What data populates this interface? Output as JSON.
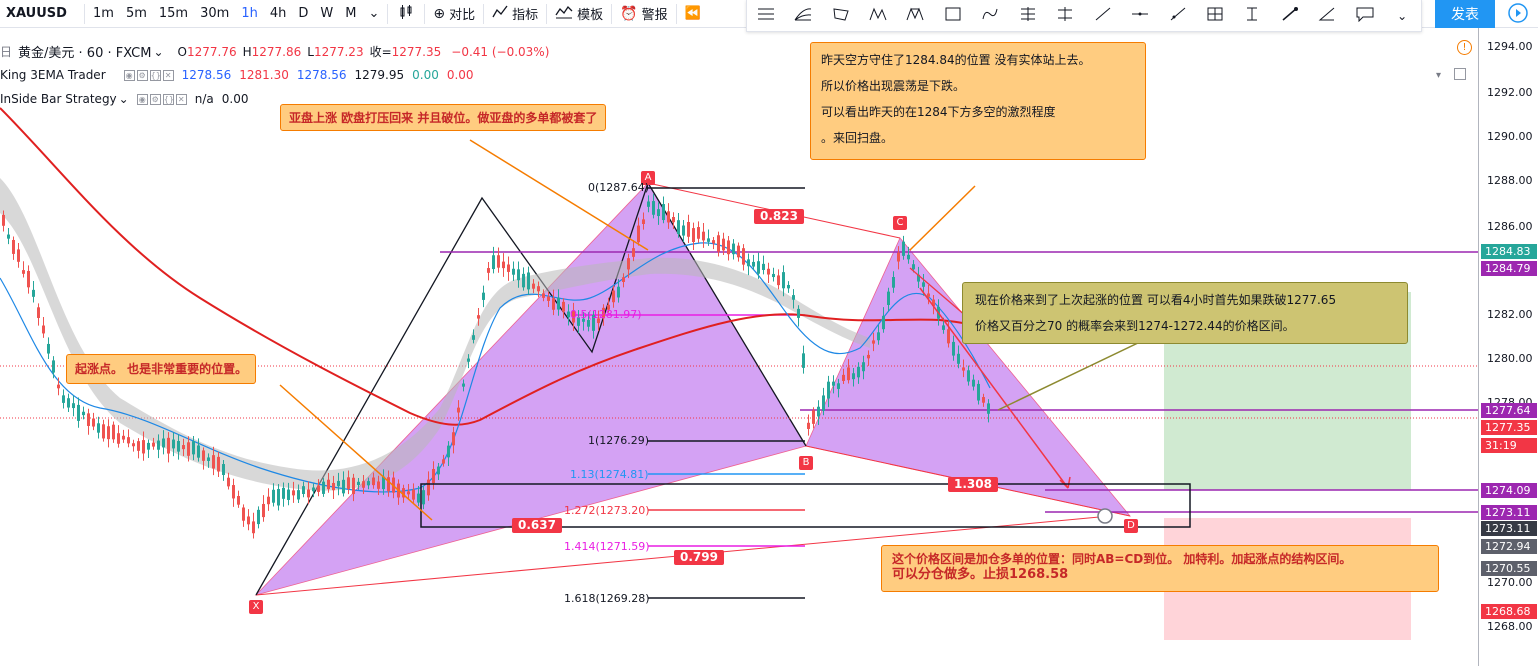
{
  "toolbar": {
    "symbol": "XAUUSD",
    "intervals": [
      "1m",
      "5m",
      "15m",
      "30m",
      "1h",
      "4h",
      "D",
      "W",
      "M"
    ],
    "active_interval": "1h",
    "compare_label": "对比",
    "indicators_label": "指标",
    "templates_label": "模板",
    "alert_label": "警报",
    "publish_label": "发表"
  },
  "legend": {
    "title": "黄金/美元 · 60 · FXCM",
    "open_label": "O",
    "open": "1277.76",
    "high_label": "H",
    "high": "1277.86",
    "low_label": "L",
    "low": "1277.23",
    "close_label": "收=",
    "close": "1277.35",
    "change": "−0.41 (−0.03%)",
    "ind1_name": "King 3EMA Trader",
    "ind1_values": [
      "1278.56",
      "1281.30",
      "1278.56",
      "1279.95",
      "0.00",
      "0.00"
    ],
    "ind2_name": "InSide Bar Strategy",
    "ind2_values": [
      "n/a",
      "0.00"
    ]
  },
  "annotations": {
    "asia": "亚盘上涨 欧盘打压回来 并且破位。做亚盘的多单都被套了",
    "yesterday": [
      "昨天空方守住了1284.84的位置 没有实体站上去。",
      "所以价格出现震荡是下跌。",
      "可以看出昨天的在1284下方多空的激烈程度",
      "。来回扫盘。"
    ],
    "now": [
      "现在价格来到了上次起涨的位置 可以看4小时首先如果跌破1277.65",
      " 价格又百分之70 的概率会来到1274-1272.44的价格区间。"
    ],
    "start": "起涨点。 也是非常重要的位置。",
    "zone": [
      "这个价格区间是加仓多单的位置：同时AB=CD到位。 加特利。加起涨点的结构区间。",
      "可以分仓做多。止损1268.58"
    ]
  },
  "pattern": {
    "points": [
      "X",
      "A",
      "B",
      "C",
      "D"
    ],
    "ratios": [
      "0.823",
      "1.308",
      "0.637",
      "0.799"
    ],
    "fib_levels": [
      {
        "label": "0(1287.64)",
        "color": "#131722"
      },
      {
        "label": "0.5(1281.97)",
        "color": "#e91ee3"
      },
      {
        "label": "1(1276.29)",
        "color": "#131722"
      },
      {
        "label": "1.13(1274.81)",
        "color": "#2196f3"
      },
      {
        "label": "1.272(1273.20)",
        "color": "#f23645"
      },
      {
        "label": "1.414(1271.59)",
        "color": "#e91ee3"
      },
      {
        "label": "1.618(1269.28)",
        "color": "#131722"
      }
    ]
  },
  "axis": {
    "ticks": [
      "1294.00",
      "1292.00",
      "1290.00",
      "1288.00",
      "1286.00",
      "1282.00",
      "1280.00",
      "1278.00",
      "1270.00",
      "1268.00"
    ],
    "badges": [
      {
        "text": "1284.83",
        "color": "#26a69a"
      },
      {
        "text": "1284.79",
        "color": "#9c27b0"
      },
      {
        "text": "1277.64",
        "color": "#9c27b0"
      },
      {
        "text": "1277.35",
        "color": "#f23645"
      },
      {
        "text": "31:19",
        "color": "#f23645"
      },
      {
        "text": "1274.09",
        "color": "#9c27b0"
      },
      {
        "text": "1273.11",
        "color": "#9c27b0"
      },
      {
        "text": "1273.11",
        "color": "#363a45"
      },
      {
        "text": "1272.94",
        "color": "#5d606b"
      },
      {
        "text": "1270.55",
        "color": "#5d606b"
      },
      {
        "text": "1268.68",
        "color": "#f23645"
      }
    ]
  }
}
